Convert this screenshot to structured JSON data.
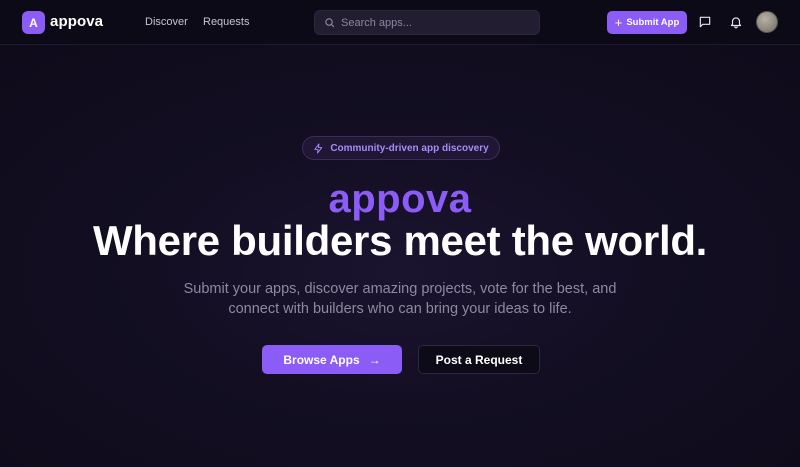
{
  "header": {
    "logo_letter": "A",
    "logo_text": "appova",
    "nav": [
      {
        "label": "Discover"
      },
      {
        "label": "Requests"
      }
    ],
    "search": {
      "placeholder": "Search apps...",
      "value": ""
    },
    "submit_label": "Submit App",
    "icons": [
      "message-icon",
      "bell-icon"
    ]
  },
  "hero": {
    "badge_text": "Community-driven app discovery",
    "brand": "appova",
    "title": "Where builders meet the world.",
    "subtitle_line1": "Submit your apps, discover amazing projects, vote for the best, and",
    "subtitle_line2": "connect with builders who can bring your ideas to life.",
    "primary_button": "Browse Apps",
    "secondary_button": "Post a Request"
  },
  "colors": {
    "accent": "#8b5cf6",
    "accent_light": "#a78bfa",
    "background": "#100c1d",
    "header_bg": "#0d0a17",
    "muted_text": "#8e88a3"
  }
}
